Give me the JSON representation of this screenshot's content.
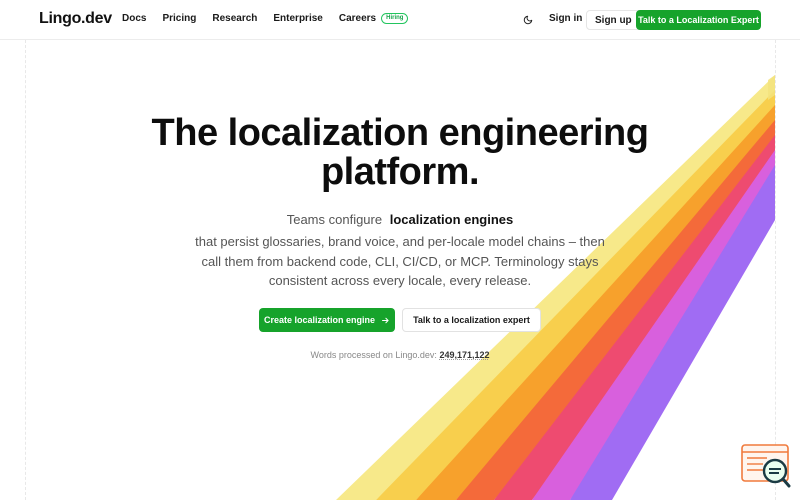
{
  "header": {
    "logo": "Lingo.dev",
    "nav": [
      {
        "label": "Docs"
      },
      {
        "label": "Pricing"
      },
      {
        "label": "Research"
      },
      {
        "label": "Enterprise"
      },
      {
        "label": "Careers",
        "badge": "Hiring"
      }
    ],
    "theme_toggle_icon": "moon-icon",
    "sign_in": "Sign in",
    "sign_up": "Sign up",
    "cta": "Talk to a Localization Expert"
  },
  "hero": {
    "title_line_1": "The localization engineering",
    "title_line_2": "platform.",
    "subtitle_prefix": "Teams configure",
    "subtitle_bold": "localization engines",
    "description": "that persist glossaries, brand voice, and per-locale model chains – then call them from backend code, CLI, CI/CD, or MCP. Terminology stays consistent across every locale, every release.",
    "primary_button": "Create localization engine",
    "primary_button_icon": "arrow-right-icon",
    "secondary_button": "Talk to a localization expert",
    "words_label": "Words processed on Lingo.dev:",
    "words_count": "249,171,122"
  },
  "colors": {
    "brand_green": "#16a32b",
    "stripe_colors": [
      "#f6e27a",
      "#f9c84a",
      "#f79a2a",
      "#f4633c",
      "#ef4a72",
      "#d95ee0",
      "#9f6df2"
    ]
  },
  "widget": {
    "icon": "chat-search-icon"
  }
}
